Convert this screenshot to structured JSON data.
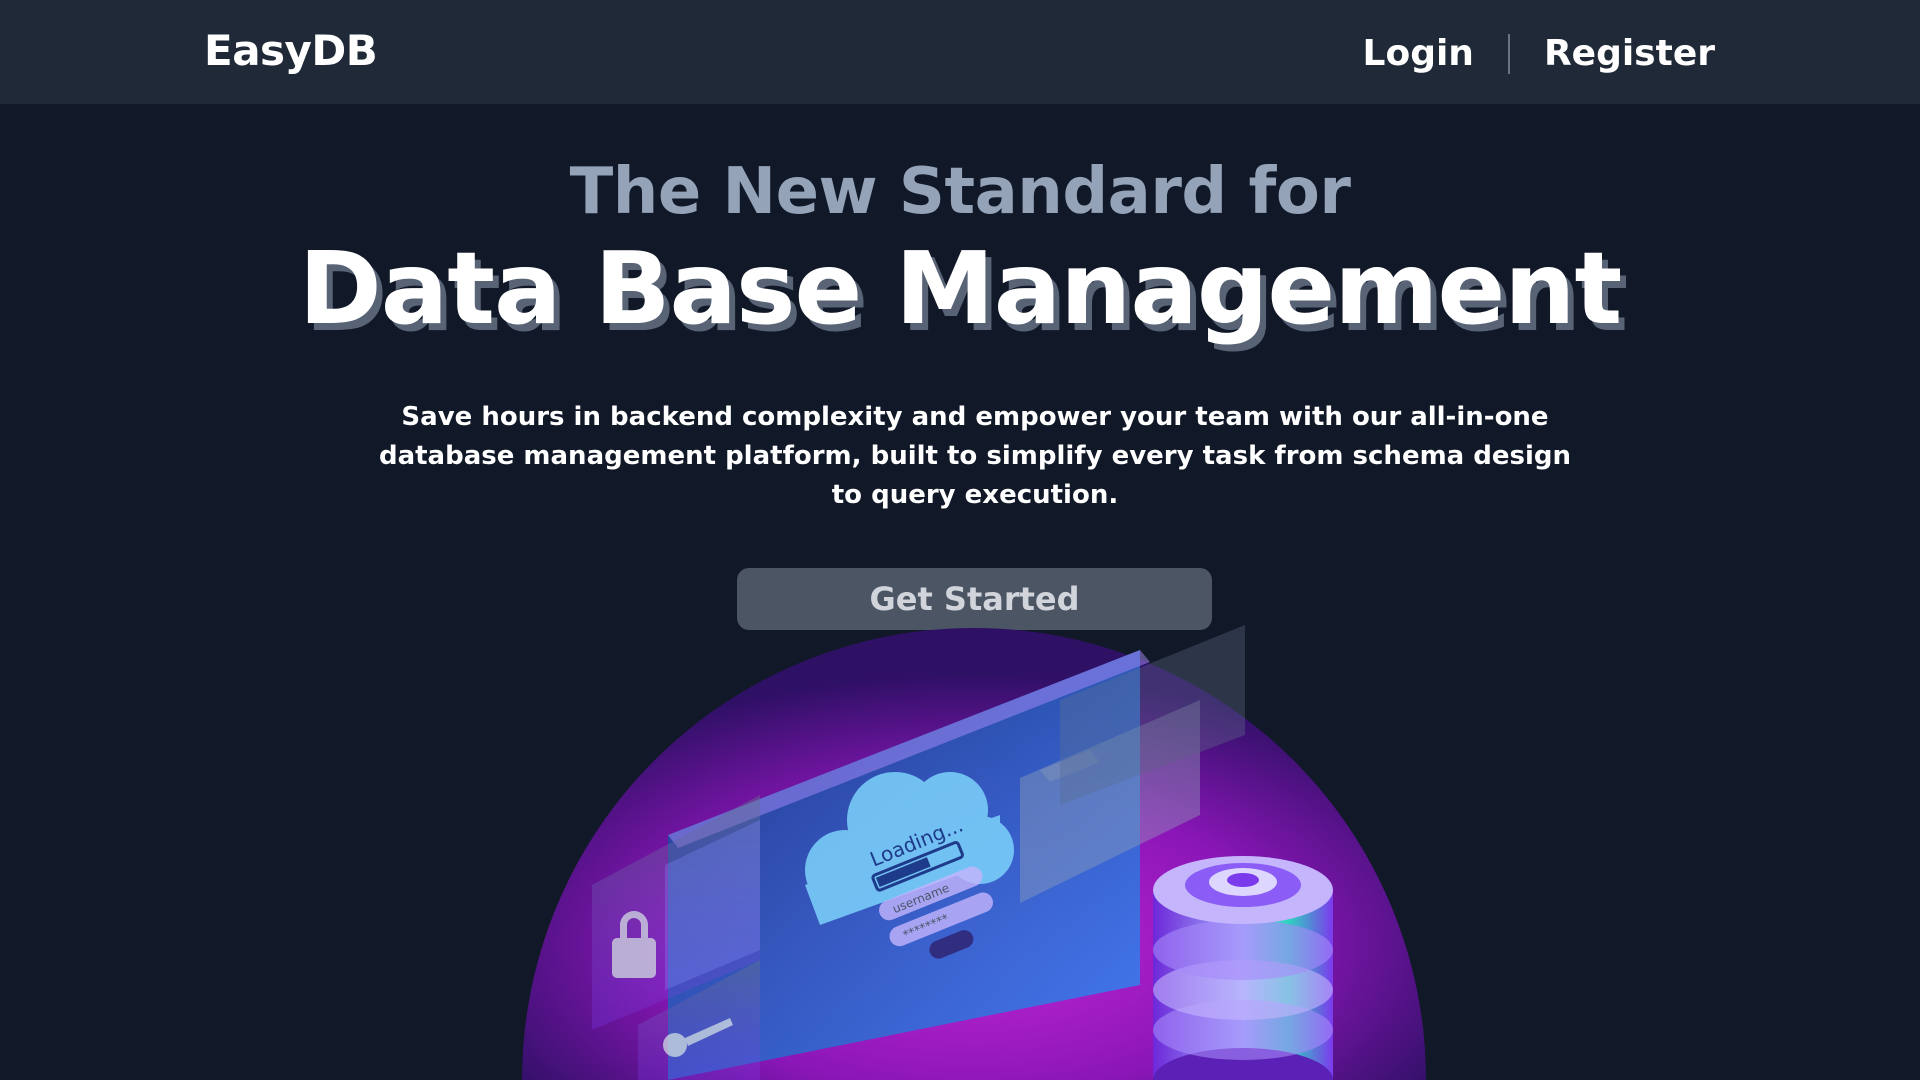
{
  "header": {
    "brand": "EasyDB",
    "nav": {
      "login": "Login",
      "register": "Register"
    }
  },
  "hero": {
    "subtitle": "The New Standard for",
    "title": "Data Base Management",
    "description": "Save hours in backend complexity and empower your team with our all-in-one database management platform, built to simplify every task from schema design to query execution.",
    "cta_label": "Get Started"
  },
  "illustration": {
    "loading_text": "Loading...",
    "username_text": "username",
    "password_text": "********"
  },
  "colors": {
    "background": "#111827",
    "header": "#1f2937",
    "accent_purple": "#9d17c9",
    "accent_blue": "#3b82f6",
    "button": "#4b5563"
  }
}
